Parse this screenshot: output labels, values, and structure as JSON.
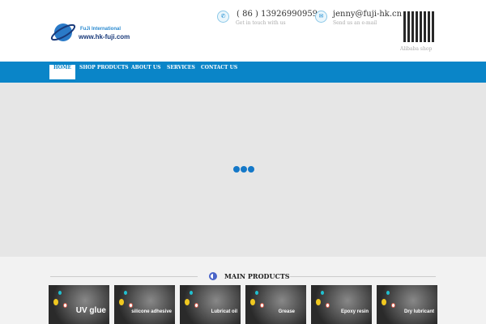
{
  "logo": {
    "line1": "FuJi International",
    "line2": "www.hk-fuji.com"
  },
  "contact": {
    "phone": "( 86 ) 13926990959",
    "phone_sub": "Get in touch with us",
    "email": "jenny@fuji-hk.cn",
    "email_sub": "Send us an e-mail",
    "qr_label": "Alibaba shop"
  },
  "nav": [
    "HOME",
    "SHOP PRODUCTS",
    "ABOUT US",
    "SERVICES",
    "CONTACT US"
  ],
  "section_title": "MAIN PRODUCTS",
  "products": [
    "UV glue",
    "silicone adhesive",
    "Lubricat oil",
    "Grease",
    "Epoxy resin",
    "Dry lubricant"
  ]
}
